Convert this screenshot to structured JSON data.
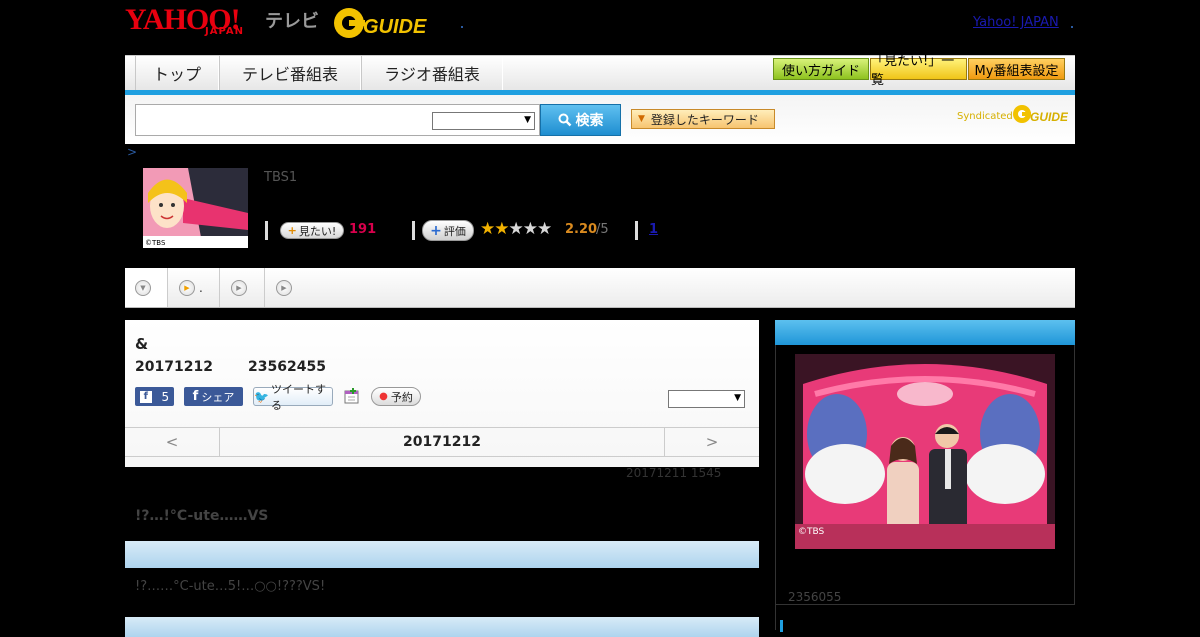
{
  "header": {
    "logo_yahoo": "YAHOO!",
    "logo_japan": "JAPAN",
    "logo_tv": "テレビ",
    "logo_gguide": "GUIDE",
    "yahoo_japan_link": "Yahoo! JAPAN"
  },
  "nav": {
    "tabs": [
      "トップ",
      "テレビ番組表",
      "ラジオ番組表"
    ],
    "guide_button": "使い方ガイド",
    "want_list_button": "「見たい!」一覧",
    "my_schedule_button": "My番組表設定"
  },
  "search": {
    "input_value": "",
    "select_value": "",
    "button_label": "検索",
    "keyword_button": "登録したキーワード",
    "syndicated": "Syndicated",
    "syndicated_logo": "GUIDE"
  },
  "breadcrumb": ">",
  "program": {
    "channel": "TBS1",
    "thumbnail_credit": "©TBS",
    "want_button": "見たい!",
    "want_count": "191",
    "rate_button": "評価",
    "rating": "2.20",
    "rating_max": "/5",
    "rating_stars": 2,
    "review_count": "1"
  },
  "subtabs": [
    "",
    ".",
    "",
    ""
  ],
  "main": {
    "title": "&",
    "date": "20171212",
    "ids": "23562455",
    "fb_count": "5",
    "fb_share": "シェア",
    "tweet": "ツイートする",
    "reserve": "予約",
    "select_value": "",
    "date_prev": "<",
    "date_current": "20171212",
    "date_next": ">"
  },
  "updated": "20171211  1545",
  "subtitle": "!?…!°C-ute……VS",
  "description": "!?……°C-ute…5!…○○!???VS!",
  "right": {
    "photo_credit": "©TBS",
    "photo_id": "2356055"
  },
  "colors": {
    "accent_blue": "#1f9fe0",
    "yahoo_red": "#e8000f",
    "gguide_yellow": "#f2c200",
    "want_pink": "#d8004c",
    "rating_orange": "#d98a1f"
  }
}
